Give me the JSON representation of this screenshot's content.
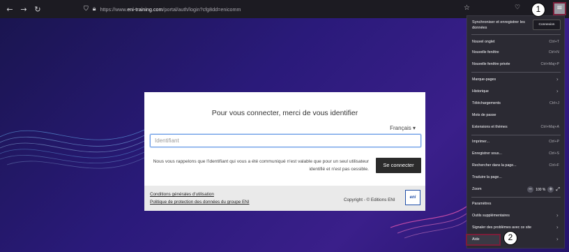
{
  "browser": {
    "url_prefix": "https://www.",
    "url_host": "eni-training.com",
    "url_path": "/portal/auth/login?cfg8dd=enicomm"
  },
  "login": {
    "title": "Pour vous connecter, merci de vous identifier",
    "language": "Français",
    "id_placeholder": "Identifiant",
    "note": "Nous vous rappelons que l'identifiant qui vous a été communiqué n'est valable que pour un seul utilisateur identifié et n'est pas cessible.",
    "submit_label": "Se connecter",
    "terms_link": "Conditions générales d'utilisation",
    "privacy_link": "Politique de protection des données du groupe ENI",
    "copyright": "Copyright - © Editions ENI",
    "logo_text": "eni"
  },
  "menu": {
    "sync_label": "Synchroniser et enregistrer les données",
    "connect_label": "Connexion",
    "items": [
      {
        "label": "Nouvel onglet",
        "shortcut": "Ctrl+T"
      },
      {
        "label": "Nouvelle fenêtre",
        "shortcut": "Ctrl+N"
      },
      {
        "label": "Nouvelle fenêtre privée",
        "shortcut": "Ctrl+Maj+P"
      },
      {
        "label": "Marque-pages",
        "shortcut": ""
      },
      {
        "label": "Historique",
        "shortcut": ""
      },
      {
        "label": "Téléchargements",
        "shortcut": "Ctrl+J"
      },
      {
        "label": "Mots de passe",
        "shortcut": ""
      },
      {
        "label": "Extensions et thèmes",
        "shortcut": "Ctrl+Maj+A"
      },
      {
        "label": "Imprimer...",
        "shortcut": "Ctrl+P"
      },
      {
        "label": "Enregistrer sous...",
        "shortcut": "Ctrl+S"
      },
      {
        "label": "Rechercher dans la page...",
        "shortcut": "Ctrl+F"
      },
      {
        "label": "Traduire la page...",
        "shortcut": ""
      },
      {
        "label": "Zoom",
        "shortcut": ""
      },
      {
        "label": "Paramètres",
        "shortcut": ""
      },
      {
        "label": "Outils supplémentaires",
        "shortcut": ""
      },
      {
        "label": "Signaler des problèmes avec ce site",
        "shortcut": ""
      },
      {
        "label": "Aide",
        "shortcut": ""
      }
    ],
    "zoom_value": "100 %"
  },
  "callouts": [
    "1",
    "2"
  ]
}
